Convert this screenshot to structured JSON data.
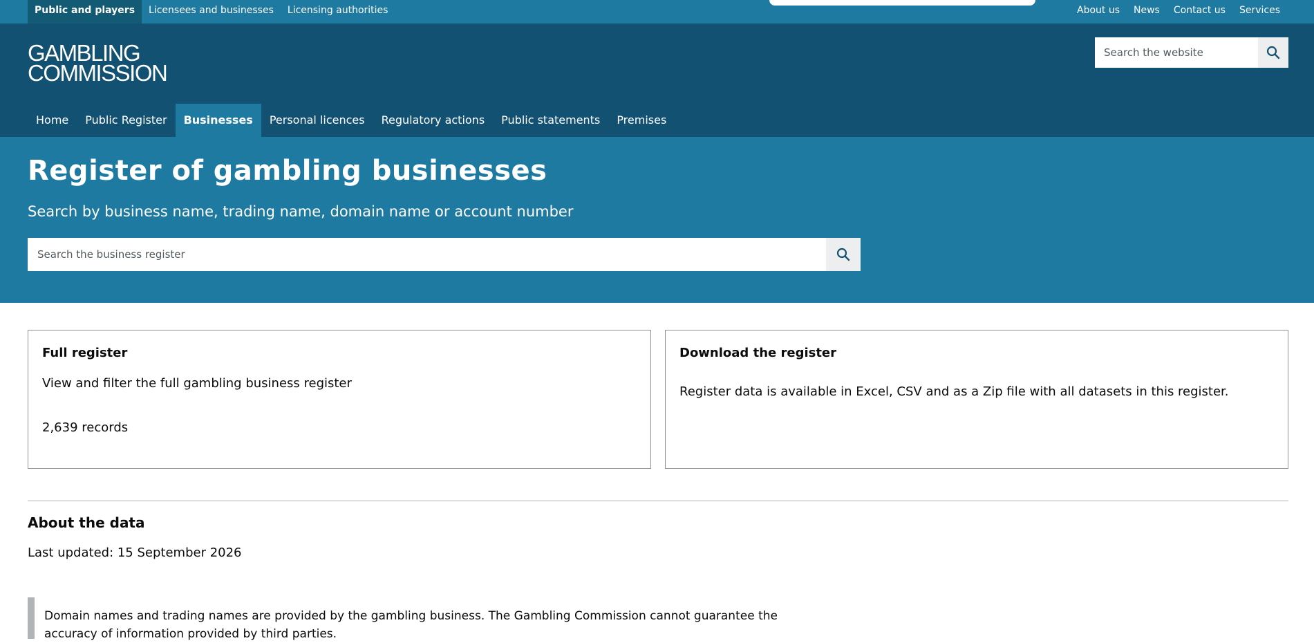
{
  "topbar": {
    "audience": [
      "Public and players",
      "Licensees and businesses",
      "Licensing authorities"
    ],
    "utility": [
      "About us",
      "News",
      "Contact us",
      "Services"
    ]
  },
  "masthead": {
    "logo_line1": "GAMBLING",
    "logo_line2": "COMMISSION",
    "search_placeholder": "Search the website",
    "search_icon": "search-icon"
  },
  "nav": {
    "items": [
      "Home",
      "Public Register",
      "Businesses",
      "Personal licences",
      "Regulatory actions",
      "Public statements",
      "Premises"
    ],
    "active": "Businesses"
  },
  "hero": {
    "title": "Register of gambling businesses",
    "subtitle": "Search by business name, trading name, domain name or account number",
    "search_placeholder": "Search the business register"
  },
  "cards": {
    "full": {
      "title": "Full register",
      "description": "View and filter the full gambling business register",
      "records": "2,639 records"
    },
    "download": {
      "title": "Download the register",
      "description": "Register data is available in Excel, CSV and as a Zip file with all datasets in this register."
    }
  },
  "about": {
    "title": "About the data",
    "updated": "Last updated: 15 September 2026",
    "note": "Domain names and trading names are provided by the gambling business. The Gambling Commission cannot guarantee the accuracy of information provided by third parties."
  },
  "colors": {
    "brand_dark": "#135172",
    "brand": "#1e7aa0",
    "nav_active": "#1e7aa0"
  }
}
